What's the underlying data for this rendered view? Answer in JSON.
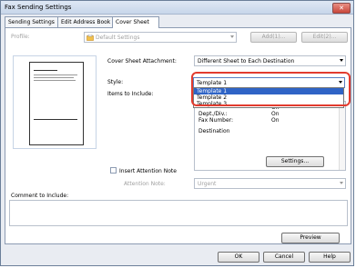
{
  "window": {
    "title": "Fax Sending Settings",
    "close_glyph": "✕"
  },
  "tabs": [
    {
      "label": "Sending Settings"
    },
    {
      "label": "Edit Address Book"
    },
    {
      "label": "Cover Sheet"
    }
  ],
  "profile": {
    "label": "Profile:",
    "value": "Default Settings",
    "add_button": "Add(1)...",
    "edit_button": "Edit(2)..."
  },
  "cover_sheet_attachment": {
    "label": "Cover Sheet Attachment:",
    "value": "Different Sheet to Each Destination"
  },
  "style": {
    "label": "Style:",
    "value": "Template 1",
    "options": [
      "Template 1",
      "Template 2",
      "Template 3"
    ],
    "selected_index": 0
  },
  "items_to_include": {
    "label": "Items to Include:",
    "rows": [
      {
        "name": "Dept./Div.:",
        "value": "On"
      },
      {
        "name": "Fax Number:",
        "value": "On"
      }
    ],
    "hidden_top_value": "On",
    "section": "Destination"
  },
  "buttons": {
    "settings": "Settings...",
    "preview": "Preview",
    "ok": "OK",
    "cancel": "Cancel",
    "help": "Help"
  },
  "attention": {
    "checkbox_label": "Insert Attention Note",
    "note_label": "Attention Note:",
    "note_value": "Urgent"
  },
  "comment": {
    "label": "Comment to Include:"
  }
}
